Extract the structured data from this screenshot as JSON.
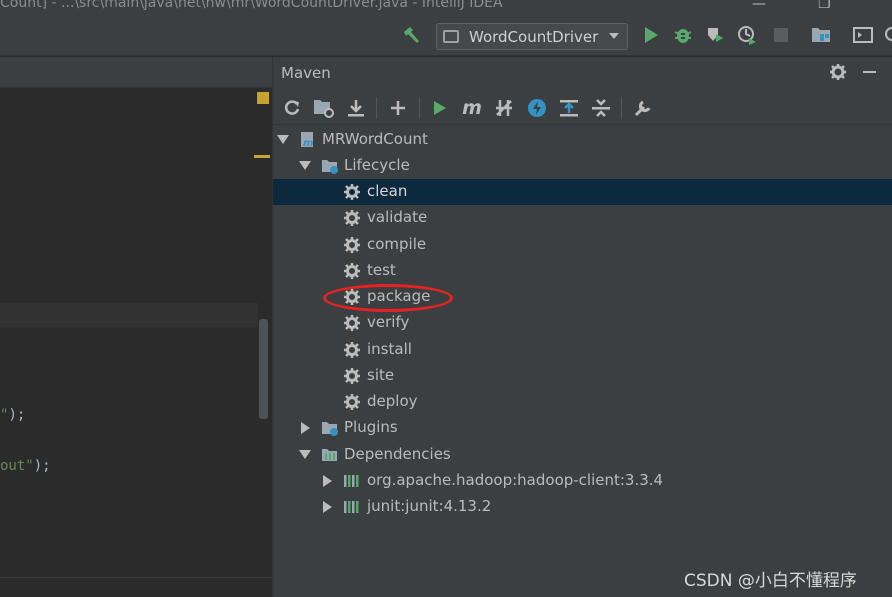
{
  "window": {
    "title": "Count] - ...\\src\\main\\java\\net\\hw\\mr\\WordCountDriver.java - IntelliJ IDEA"
  },
  "toolbar": {
    "run_config": "WordCountDriver",
    "icons": [
      "hammer-icon",
      "run-icon",
      "debug-icon",
      "coverage-icon",
      "profile-icon",
      "stop-icon",
      "project-structure-icon",
      "terminal-icon",
      "search-icon"
    ]
  },
  "editor": {
    "code_lines": [
      "\");",
      "out\");"
    ]
  },
  "maven": {
    "title": "Maven",
    "project": "MRWordCount",
    "lifecycle_label": "Lifecycle",
    "lifecycle": [
      "clean",
      "validate",
      "compile",
      "test",
      "package",
      "verify",
      "install",
      "site",
      "deploy"
    ],
    "selected": "clean",
    "highlighted": "package",
    "plugins_label": "Plugins",
    "dependencies_label": "Dependencies",
    "dependencies": [
      "org.apache.hadoop:hadoop-client:3.3.4",
      "junit:junit:4.13.2"
    ]
  },
  "watermark": "CSDN @小白不懂程序",
  "colors": {
    "selection": "#0d293e",
    "run_green": "#59a869",
    "annotation_red": "#e82222",
    "background": "#3c3f41"
  }
}
